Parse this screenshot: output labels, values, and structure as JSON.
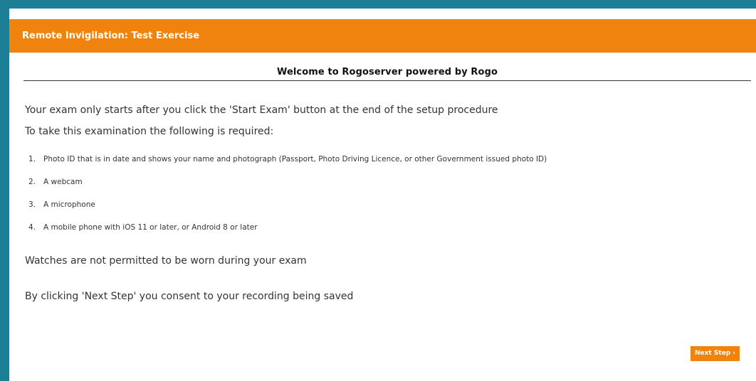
{
  "header": {
    "title": "Remote Invigilation: Test Exercise"
  },
  "welcome": {
    "heading": "Welcome to Rogoserver powered by Rogo"
  },
  "intro": {
    "line1": "Your exam only starts after you click the 'Start Exam' button at the end of the setup procedure",
    "line2": "To take this examination the following is required:"
  },
  "requirements": [
    {
      "num": "1.",
      "text": "Photo ID that is in date and shows your name and photograph (Passport, Photo Driving Licence, or other Government issued photo ID)"
    },
    {
      "num": "2.",
      "text": "A webcam"
    },
    {
      "num": "3.",
      "text": "A microphone"
    },
    {
      "num": "4.",
      "text": "A mobile phone with iOS 11 or later, or Android 8 or later"
    }
  ],
  "notes": {
    "watches": "Watches are not permitted to be worn during your exam",
    "consent": "By clicking 'Next Step' you consent to your recording being saved"
  },
  "buttons": {
    "next_step": "Next Step ›"
  },
  "colors": {
    "accent": "#f0820e",
    "frame": "#1d7f96",
    "text": "#333333"
  }
}
